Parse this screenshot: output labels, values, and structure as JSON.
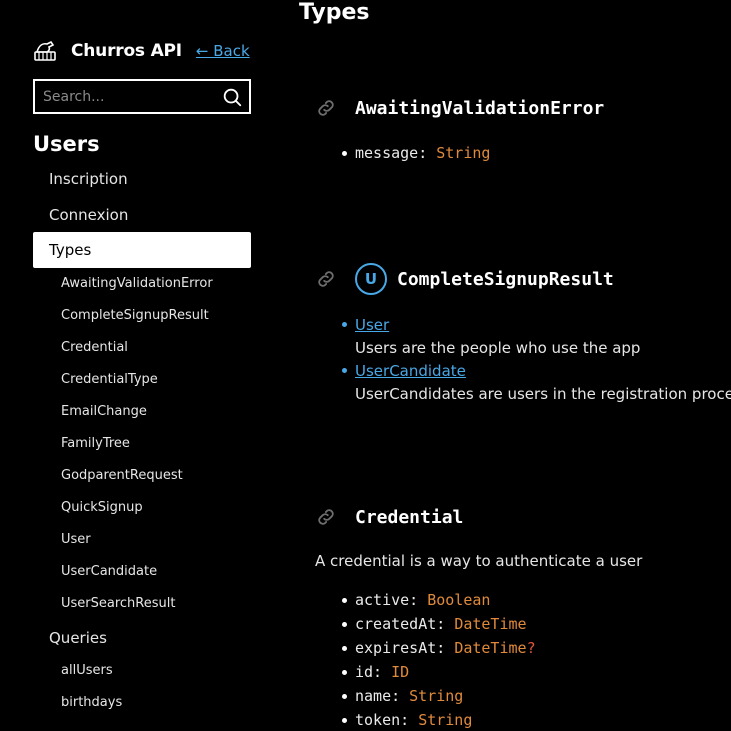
{
  "brand": {
    "name": "Churros API",
    "back_label": "← Back",
    "logo_icon": "churros-logo-icon"
  },
  "search": {
    "placeholder": "Search...",
    "value": ""
  },
  "sidebar": {
    "section_title": "Users",
    "items": [
      {
        "label": "Inscription"
      },
      {
        "label": "Connexion"
      },
      {
        "label": "Types",
        "active": true
      }
    ],
    "types_sub": [
      "AwaitingValidationError",
      "CompleteSignupResult",
      "Credential",
      "CredentialType",
      "EmailChange",
      "FamilyTree",
      "GodparentRequest",
      "QuickSignup",
      "User",
      "UserCandidate",
      "UserSearchResult"
    ],
    "queries_label": "Queries",
    "queries_sub": [
      "allUsers",
      "birthdays"
    ]
  },
  "main": {
    "page_title": "Types",
    "types": {
      "awaiting": {
        "name": "AwaitingValidationError",
        "fields": [
          {
            "name": "message:",
            "type": "String"
          }
        ]
      },
      "complete": {
        "name": "CompleteSignupResult",
        "badge": "U",
        "members": [
          {
            "link": "User",
            "description": "Users are the people who use the app"
          },
          {
            "link": "UserCandidate",
            "description": "UserCandidates are users in the registration process"
          }
        ]
      },
      "credential": {
        "name": "Credential",
        "description": "A credential is a way to authenticate a user",
        "fields": [
          {
            "name": "active:",
            "type": "Boolean"
          },
          {
            "name": "createdAt:",
            "type": "DateTime"
          },
          {
            "name": "expiresAt:",
            "type": "DateTime",
            "nullable": "?"
          },
          {
            "name": "id:",
            "type": "ID"
          },
          {
            "name": "name:",
            "type": "String"
          },
          {
            "name": "token:",
            "type": "String"
          }
        ]
      }
    }
  },
  "colors": {
    "accent": "#49a8e6",
    "type": "#e08a3c",
    "nullable": "#e0553c",
    "background": "#000000"
  }
}
